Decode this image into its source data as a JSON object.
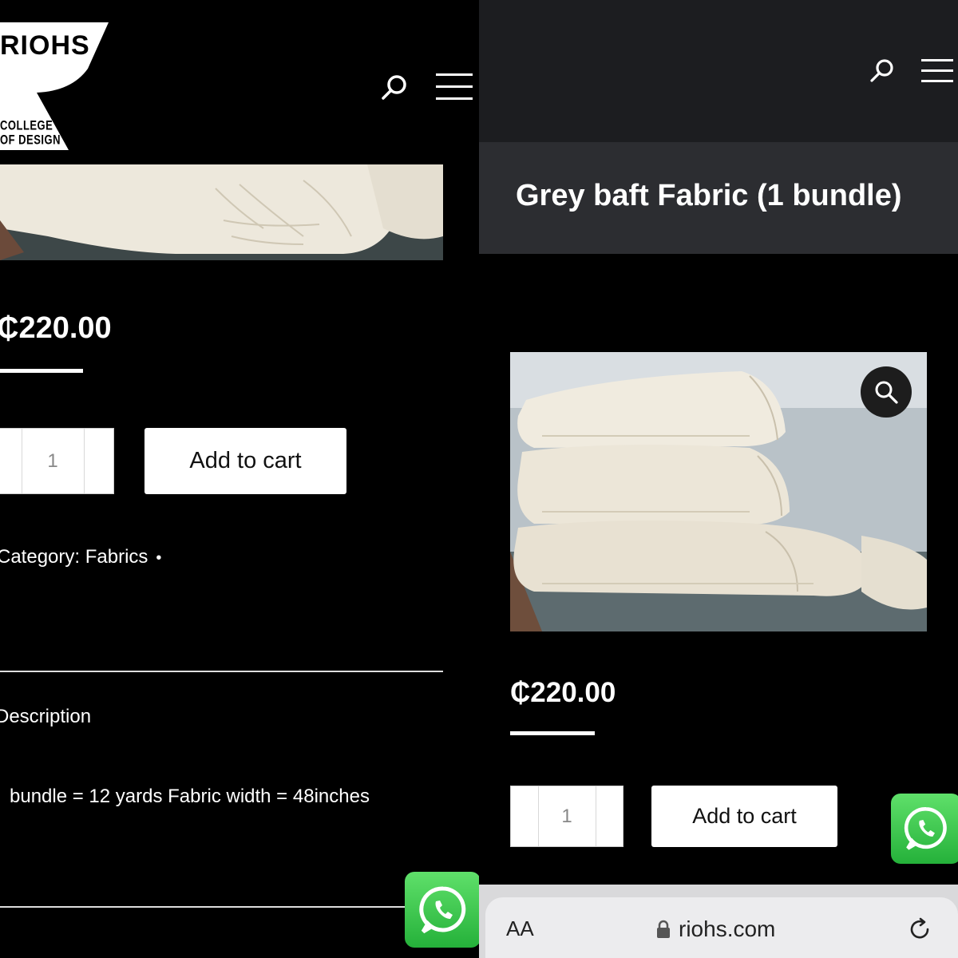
{
  "left": {
    "logo": {
      "brand": "RIOHS",
      "subtitle_line1": "COLLEGE",
      "subtitle_line2": "OF DESIGN"
    },
    "price": "₵220.00",
    "quantity": "1",
    "add_to_cart": "Add to cart",
    "category": "Category: Fabrics",
    "category_sep": "•",
    "description_heading": "Description",
    "description_text": "bundle = 12 yards Fabric width = 48inches"
  },
  "right": {
    "title": "Grey baft Fabric (1 bundle)",
    "price": "₵220.00",
    "quantity": "1",
    "add_to_cart": "Add to cart",
    "browser": {
      "text_size": "AA",
      "url": "riohs.com"
    }
  },
  "icons": [
    "search-icon",
    "hamburger-menu-icon",
    "zoom-icon",
    "whatsapp-icon",
    "lock-icon",
    "reload-icon"
  ],
  "colors": {
    "background": "#000000",
    "header": "#1c1d20",
    "title_bar": "#2c2d31",
    "whatsapp": "#25b13a",
    "button": "#ffffff"
  }
}
